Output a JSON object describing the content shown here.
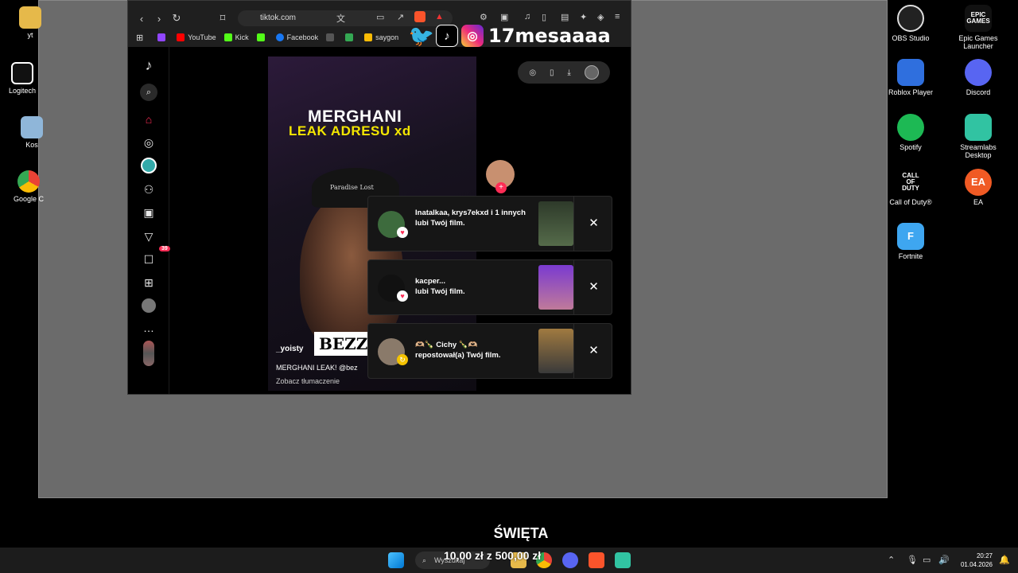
{
  "desktop": {
    "left_icons": [
      {
        "label": "yt"
      },
      {
        "label": "Logitech"
      },
      {
        "label": "Kos"
      },
      {
        "label": "Google C"
      }
    ],
    "right_icons": [
      {
        "label": "OBS Studio"
      },
      {
        "label": "Epic Games Launcher",
        "badge": "EPIC GAMES"
      },
      {
        "label": "Roblox Player"
      },
      {
        "label": "Discord"
      },
      {
        "label": "Spotify"
      },
      {
        "label": "Streamlabs Desktop"
      },
      {
        "label": "Call of Duty®",
        "badge": "CALL OF DUTY"
      },
      {
        "label": "EA",
        "badge": "EA"
      },
      {
        "label": "Fortnite",
        "badge": "F"
      }
    ]
  },
  "browser": {
    "url": "tiktok.com",
    "bookmarks": [
      "YouTube",
      "Kick",
      "Facebook",
      "saygon"
    ]
  },
  "tiktok": {
    "sidebar_badge": "39",
    "video": {
      "title_line1": "MERGHANI",
      "title_line2": "LEAK ADRESU xd",
      "cap_text": "Paradise Lost",
      "overlay_text": "BEZZ",
      "username": "_yoisty",
      "caption": "MERGHANI LEAK! @bez",
      "translate": "Zobacz tłumaczenie",
      "progress": 0.37
    },
    "notifications": [
      {
        "text": "Inatalkaa, krys7ekxd i 1 innych",
        "action": "lubi Twój film."
      },
      {
        "text": "kacper...",
        "action": "lubi Twój film."
      },
      {
        "text": "🫶🏼🍾 Cichy 🍾🫶🏼",
        "action": "repostował(a) Twój film."
      }
    ]
  },
  "stream_overlay": {
    "handle": "17mesaaaa",
    "banner": "ŚWIĘTA",
    "donation": "10,00 zł z 500,00 zł"
  },
  "taskbar": {
    "search_placeholder": "Wyszukaj",
    "time": "20:27",
    "date": "01.04.2026"
  }
}
